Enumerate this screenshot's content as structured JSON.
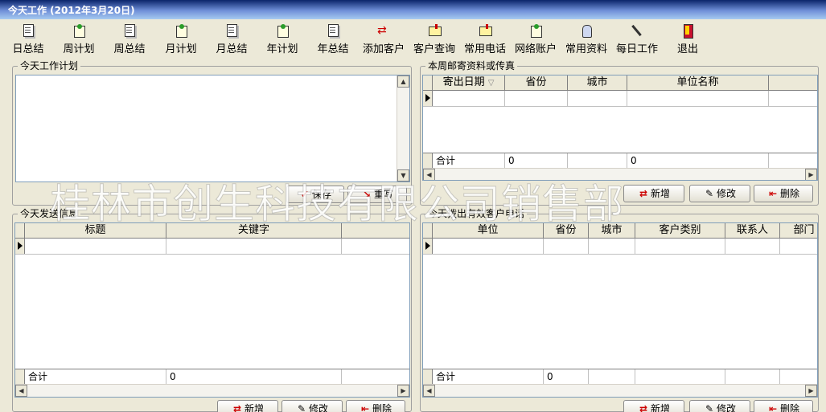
{
  "window": {
    "title": "今天工作 (2012年3月20日)"
  },
  "toolbar": {
    "items": [
      {
        "label": "日总结",
        "icon": "document-icon"
      },
      {
        "label": "周计划",
        "icon": "plan-icon"
      },
      {
        "label": "周总结",
        "icon": "document-icon"
      },
      {
        "label": "月计划",
        "icon": "plan-icon"
      },
      {
        "label": "月总结",
        "icon": "document-icon"
      },
      {
        "label": "年计划",
        "icon": "plan-icon"
      },
      {
        "label": "年总结",
        "icon": "document-icon"
      },
      {
        "label": "添加客户",
        "icon": "add-customer-icon"
      },
      {
        "label": "客户查询",
        "icon": "customer-card-icon"
      },
      {
        "label": "常用电话",
        "icon": "phone-card-icon"
      },
      {
        "label": "网络账户",
        "icon": "network-account-icon"
      },
      {
        "label": "常用资料",
        "icon": "people-icon"
      },
      {
        "label": "每日工作",
        "icon": "pen-icon"
      },
      {
        "label": "退出",
        "icon": "exit-icon"
      }
    ]
  },
  "plan": {
    "title": "今天工作计划",
    "save_label": "保存",
    "rewrite_label": "重写"
  },
  "mail": {
    "title": "本周邮寄资料或传真",
    "columns": [
      "寄出日期",
      "省份",
      "城市",
      "单位名称"
    ],
    "sort_indicator": "▽",
    "total_label": "合计",
    "total_values": [
      "0",
      "0"
    ],
    "buttons": {
      "add": "新增",
      "edit": "修改",
      "delete": "删除"
    }
  },
  "sent": {
    "title": "今天发送信息",
    "columns": [
      "标题",
      "关键字"
    ],
    "total_label": "合计",
    "total_values": [
      "0"
    ],
    "buttons": {
      "add": "新增",
      "edit": "修改",
      "delete": "删除"
    }
  },
  "calls": {
    "title": "今天拨出有效客户电话",
    "columns": [
      "单位",
      "省份",
      "城市",
      "客户类别",
      "联系人",
      "部门"
    ],
    "total_label": "合计",
    "total_values": [
      "0"
    ],
    "buttons": {
      "add": "新增",
      "edit": "修改",
      "delete": "删除"
    }
  },
  "watermark": {
    "text": "桂林市创生科技有限公司销售部"
  }
}
